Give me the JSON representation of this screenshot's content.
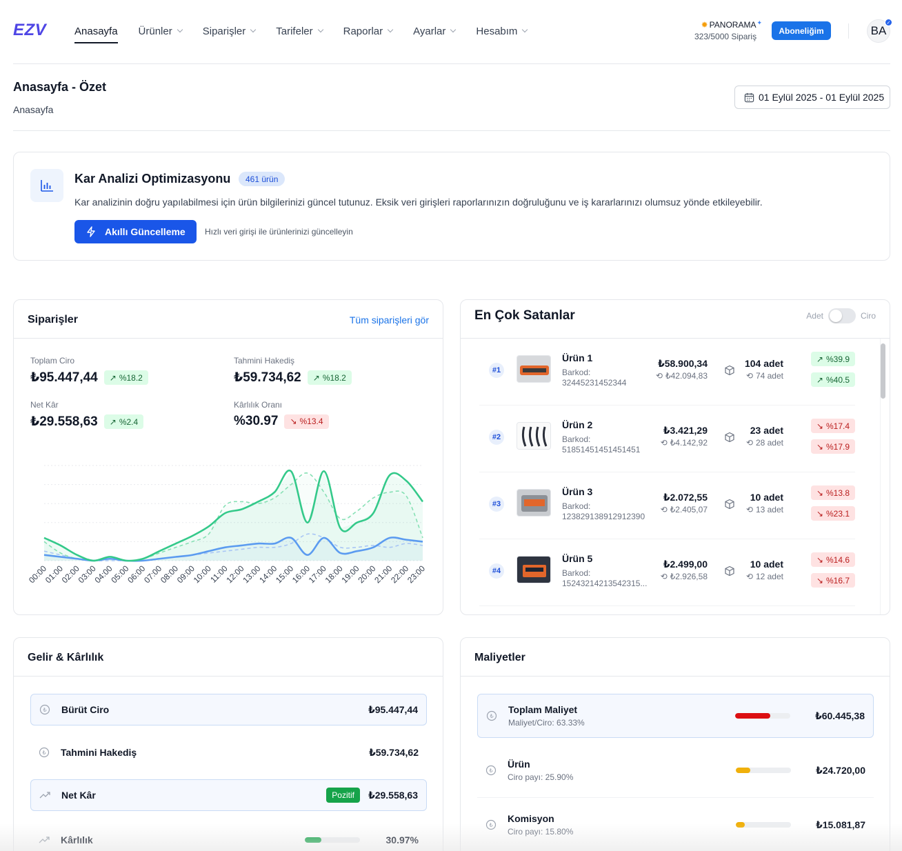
{
  "header": {
    "logo": "EZV",
    "nav": [
      {
        "label": "Anasayfa",
        "active": true,
        "dropdown": false
      },
      {
        "label": "Ürünler",
        "dropdown": true
      },
      {
        "label": "Siparişler",
        "dropdown": true
      },
      {
        "label": "Tarifeler",
        "dropdown": true
      },
      {
        "label": "Raporlar",
        "dropdown": true
      },
      {
        "label": "Ayarlar",
        "dropdown": true
      },
      {
        "label": "Hesabım",
        "dropdown": true
      }
    ],
    "plan_name": "PANORAMA",
    "plan_usage": "323/5000 Sipariş",
    "subscription_button": "Aboneliğim",
    "avatar_initials": "BA"
  },
  "page": {
    "title": "Anasayfa - Özet",
    "breadcrumb": "Anasayfa",
    "date_range": "01 Eylül 2025 - 01 Eylül 2025"
  },
  "profit_analysis": {
    "title": "Kar Analizi Optimizasyonu",
    "badge": "461 ürün",
    "description": "Kar analizinin doğru yapılabilmesi için ürün bilgilerinizi güncel tutunuz. Eksik veri girişleri raporlarınızın doğruluğunu ve iş kararlarınızı olumsuz yönde etkileyebilir.",
    "button": "Akıllı Güncelleme",
    "hint": "Hızlı veri girişi ile ürünlerinizi güncelleyin"
  },
  "orders": {
    "title": "Siparişler",
    "link": "Tüm siparişleri gör",
    "metrics": [
      {
        "label": "Toplam Ciro",
        "value": "₺95.447,44",
        "change": "%18.2",
        "trend": "up"
      },
      {
        "label": "Tahmini Hakediş",
        "value": "₺59.734,62",
        "change": "%18.2",
        "trend": "up"
      },
      {
        "label": "Net Kâr",
        "value": "₺29.558,63",
        "change": "%2.4",
        "trend": "up"
      },
      {
        "label": "Kârlılık Oranı",
        "value": "%30.97",
        "change": "%13.4",
        "trend": "down"
      }
    ]
  },
  "chart_data": {
    "type": "area",
    "x": [
      "00:00",
      "01:00",
      "02:00",
      "03:00",
      "04:00",
      "05:00",
      "06:00",
      "07:00",
      "08:00",
      "09:00",
      "10:00",
      "11:00",
      "12:00",
      "13:00",
      "14:00",
      "15:00",
      "16:00",
      "17:00",
      "18:00",
      "19:00",
      "20:00",
      "21:00",
      "22:00",
      "23:00"
    ],
    "series": [
      {
        "color": "#34c98a",
        "style": "solid",
        "values": [
          12,
          8,
          3,
          0,
          2,
          0,
          1,
          5,
          9,
          13,
          18,
          25,
          27,
          31,
          36,
          47,
          20,
          47,
          17,
          20,
          25,
          45,
          42,
          31
        ]
      },
      {
        "color": "#86e0b4",
        "style": "dashed",
        "values": [
          10,
          4,
          1,
          0,
          1,
          0,
          1,
          4,
          7,
          10,
          14,
          29,
          31,
          30,
          33,
          40,
          46,
          36,
          22,
          26,
          33,
          36,
          34,
          12
        ]
      },
      {
        "color": "#5b9bf0",
        "style": "solid",
        "values": [
          3,
          2,
          1,
          0,
          1,
          0,
          0,
          1,
          2,
          3,
          5,
          7,
          8,
          9,
          9,
          12,
          3,
          12,
          4,
          5,
          7,
          12,
          11,
          10
        ]
      },
      {
        "color": "#a9c6f5",
        "style": "dashed",
        "values": [
          5,
          3,
          1,
          0,
          0,
          0,
          0,
          1,
          2,
          3,
          4,
          5,
          6,
          7,
          7,
          9,
          14,
          12,
          7,
          7,
          8,
          7,
          9,
          8
        ]
      }
    ],
    "ylim": [
      0,
      50
    ],
    "grid": true
  },
  "best_sellers": {
    "title": "En Çok Satanlar",
    "toggle_left": "Adet",
    "toggle_right": "Ciro",
    "barcode_label": "Barkod:",
    "items": [
      {
        "rank": "#1",
        "name": "Ürün 1",
        "barcode": "32445231452344",
        "price": "₺58.900,34",
        "prev_price": "₺42.094,83",
        "qty": "104 adet",
        "prev_qty": "74 adet",
        "change1": "%39.9",
        "trend1": "up",
        "change2": "%40.5",
        "trend2": "up"
      },
      {
        "rank": "#2",
        "name": "Ürün 2",
        "barcode": "51851451451451451",
        "price": "₺3.421,29",
        "prev_price": "₺4.142,92",
        "qty": "23 adet",
        "prev_qty": "28 adet",
        "change1": "%17.4",
        "trend1": "down",
        "change2": "%17.9",
        "trend2": "down"
      },
      {
        "rank": "#3",
        "name": "Ürün 3",
        "barcode": "123829138912912390",
        "price": "₺2.072,55",
        "prev_price": "₺2.405,07",
        "qty": "10 adet",
        "prev_qty": "13 adet",
        "change1": "%13.8",
        "trend1": "down",
        "change2": "%23.1",
        "trend2": "down"
      },
      {
        "rank": "#4",
        "name": "Ürün 5",
        "barcode": "15243214213542315...",
        "price": "₺2.499,00",
        "prev_price": "₺2.926,58",
        "qty": "10 adet",
        "prev_qty": "12 adet",
        "change1": "%14.6",
        "trend1": "down",
        "change2": "%16.7",
        "trend2": "down"
      }
    ]
  },
  "income": {
    "title": "Gelir & Kârlılık",
    "rows": [
      {
        "label": "Bürüt Ciro",
        "value": "₺95.447,44"
      },
      {
        "label": "Tahmini Hakediş",
        "value": "₺59.734,62"
      },
      {
        "label": "Net Kâr",
        "value": "₺29.558,63",
        "badge": "Pozitif"
      },
      {
        "label": "Kârlılık",
        "value": "30.97%",
        "progress": 0.3097
      }
    ]
  },
  "costs": {
    "title": "Maliyetler",
    "rows": [
      {
        "label": "Toplam Maliyet",
        "sub": "Maliyet/Ciro: 63.33%",
        "value": "₺60.445,38",
        "progress": 0.6333,
        "color": "#dc0f12"
      },
      {
        "label": "Ürün",
        "sub": "Ciro payı: 25.90%",
        "value": "₺24.720,00",
        "progress": 0.259,
        "color": "#f0b00b"
      },
      {
        "label": "Komisyon",
        "sub": "Ciro payı: 15.80%",
        "value": "₺15.081,87",
        "progress": 0.158,
        "color": "#f0b00b"
      }
    ]
  },
  "colors": {
    "brand": "#4f46e5",
    "primary": "#1a73e8",
    "positive": "#16a34a",
    "negative": "#dc2626"
  }
}
